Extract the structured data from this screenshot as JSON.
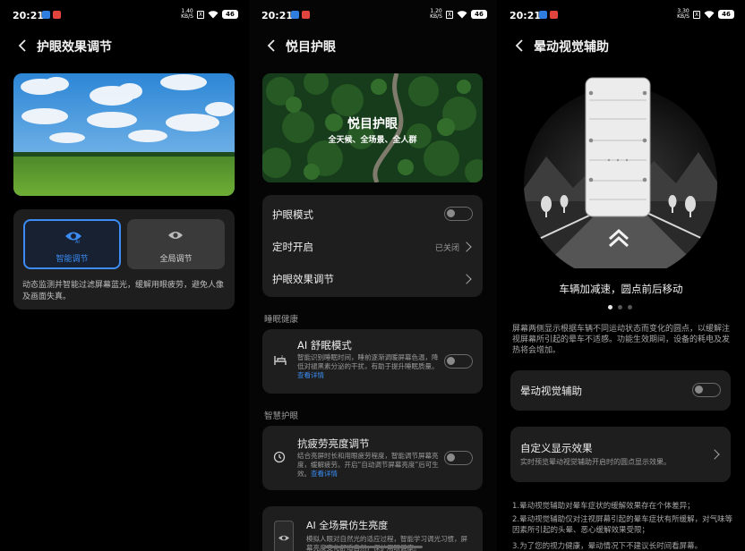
{
  "status_bar": {
    "time": "20:21",
    "battery": "46",
    "p1_speed": [
      "1.40",
      "KB/S"
    ],
    "p2_speed": [
      "1.20",
      "KB/S"
    ],
    "p3_speed": [
      "3.30",
      "KB/S"
    ],
    "sim_badge": "X"
  },
  "screen1": {
    "title": "护眼效果调节",
    "modes": [
      {
        "label": "智能调节",
        "icon_text": "AI",
        "selected": true
      },
      {
        "label": "全局调节",
        "selected": false
      }
    ],
    "description": "动态监测并智能过滤屏幕蓝光，缓解用眼疲劳，避免人像及画面失真。"
  },
  "screen2": {
    "title": "悦目护眼",
    "banner": {
      "title": "悦目护眼",
      "subtitle": "全天候、全场景、全人群"
    },
    "rows": [
      {
        "label": "护眼模式",
        "control": "toggle"
      },
      {
        "label": "定时开启",
        "value": "已关闭",
        "control": "chevron"
      },
      {
        "label": "护眼效果调节",
        "control": "chevron"
      }
    ],
    "section_sleep": "睡眠健康",
    "ai_sleep": {
      "title": "AI 舒眠模式",
      "desc": "智能识别睡眠时间，睡前逐渐调暖屏幕色温，降低对褪黑素分泌的干扰，有助于提升睡眠质量。",
      "link": "查看详情"
    },
    "section_smart": "智慧护眼",
    "anti_fatigue": {
      "title": "抗疲劳亮度调节",
      "desc": "结合亮屏时长和用眼疲劳程度，智能调节屏幕亮度，缓解疲劳。开启“自动调节屏幕亮度”后可生效。",
      "link": "查看详情"
    },
    "ai_scene": {
      "title": "AI 全场景仿生亮度",
      "desc": "模拟人眼对自然光的适应过程，智能学习调光习惯，屏幕亮度变化舒适自然，保护用眼健康。"
    }
  },
  "screen3": {
    "title": "晕动视觉辅助",
    "caption": "车辆加减速，圆点前后移动",
    "description": "屏幕两侧显示根据车辆不同运动状态而变化的圆点，以缓解注视屏幕所引起的晕车不适感。功能生效期间，设备的耗电及发热将会增加。",
    "toggle_label": "晕动视觉辅助",
    "custom_title": "自定义显示效果",
    "custom_sub": "实时预览晕动视觉辅助开启时的圆点显示效果。",
    "notes": [
      "1.晕动视觉辅助对晕车症状的缓解效果存在个体差异；",
      "2.晕动视觉辅助仅对注视屏幕引起的晕车症状有所缓解，对气味等因素所引起的头晕、恶心缓解效果受限；",
      "3.为了您的视力健康，晕动情况下不建议长时间看屏幕。"
    ]
  },
  "colors": {
    "accent": "#3b8cf5",
    "card": "#1e1e1e",
    "background": "#000000"
  }
}
